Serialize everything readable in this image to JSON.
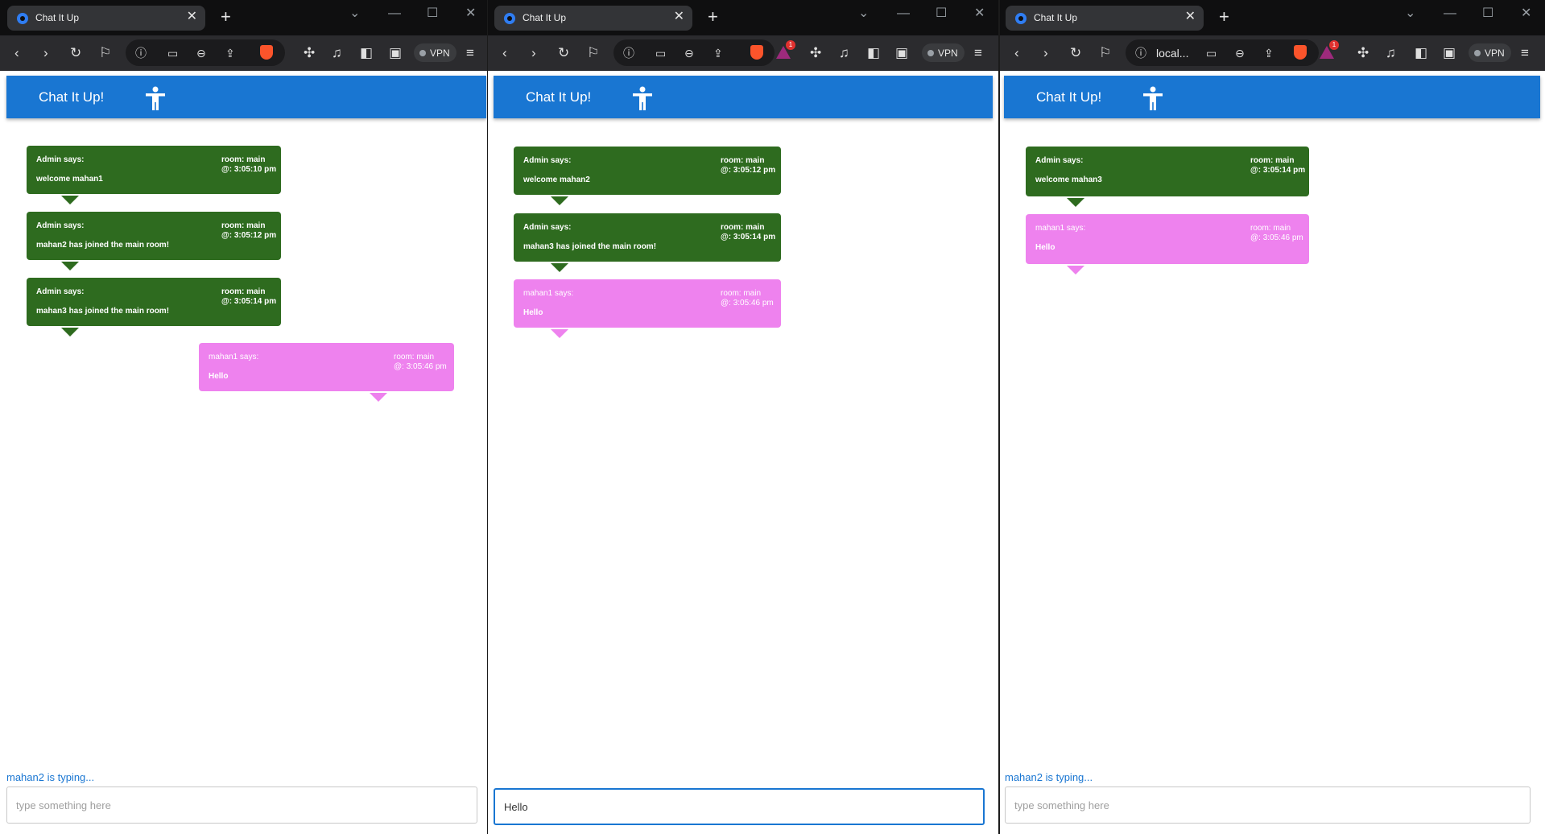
{
  "browser": {
    "tab_title": "Chat It Up",
    "tab_close": "✕",
    "new_tab": "+",
    "vpn_label": "VPN",
    "omnibox_url_partial": "local...",
    "notification_count": "1"
  },
  "app": {
    "title": "Chat It Up!",
    "accent_color": "#1976d2",
    "admin_color": "#2e6b1f",
    "user_color": "#ee82ee"
  },
  "windows": [
    {
      "messages": [
        {
          "from": "Admin says:",
          "room": "room: main",
          "time": "@: 3:05:10 pm",
          "text": "welcome mahan1"
        },
        {
          "from": "Admin says:",
          "room": "room: main",
          "time": "@: 3:05:12 pm",
          "text": "mahan2 has joined the main room!"
        },
        {
          "from": "Admin says:",
          "room": "room: main",
          "time": "@: 3:05:14 pm",
          "text": "mahan3 has joined the main room!"
        },
        {
          "from": "mahan1 says:",
          "room": "room: main",
          "time": "@: 3:05:46 pm",
          "text": "Hello"
        }
      ],
      "typing": "mahan2 is typing...",
      "input_placeholder": "type something here",
      "input_value": ""
    },
    {
      "messages": [
        {
          "from": "Admin says:",
          "room": "room: main",
          "time": "@: 3:05:12 pm",
          "text": "welcome mahan2"
        },
        {
          "from": "Admin says:",
          "room": "room: main",
          "time": "@: 3:05:14 pm",
          "text": "mahan3 has joined the main room!"
        },
        {
          "from": "mahan1 says:",
          "room": "room: main",
          "time": "@: 3:05:46 pm",
          "text": "Hello"
        }
      ],
      "typing": "",
      "input_placeholder": "",
      "input_value": "Hello"
    },
    {
      "messages": [
        {
          "from": "Admin says:",
          "room": "room: main",
          "time": "@: 3:05:14 pm",
          "text": "welcome mahan3"
        },
        {
          "from": "mahan1 says:",
          "room": "room: main",
          "time": "@: 3:05:46 pm",
          "text": "Hello"
        }
      ],
      "typing": "mahan2 is typing...",
      "input_placeholder": "type something here",
      "input_value": ""
    }
  ]
}
